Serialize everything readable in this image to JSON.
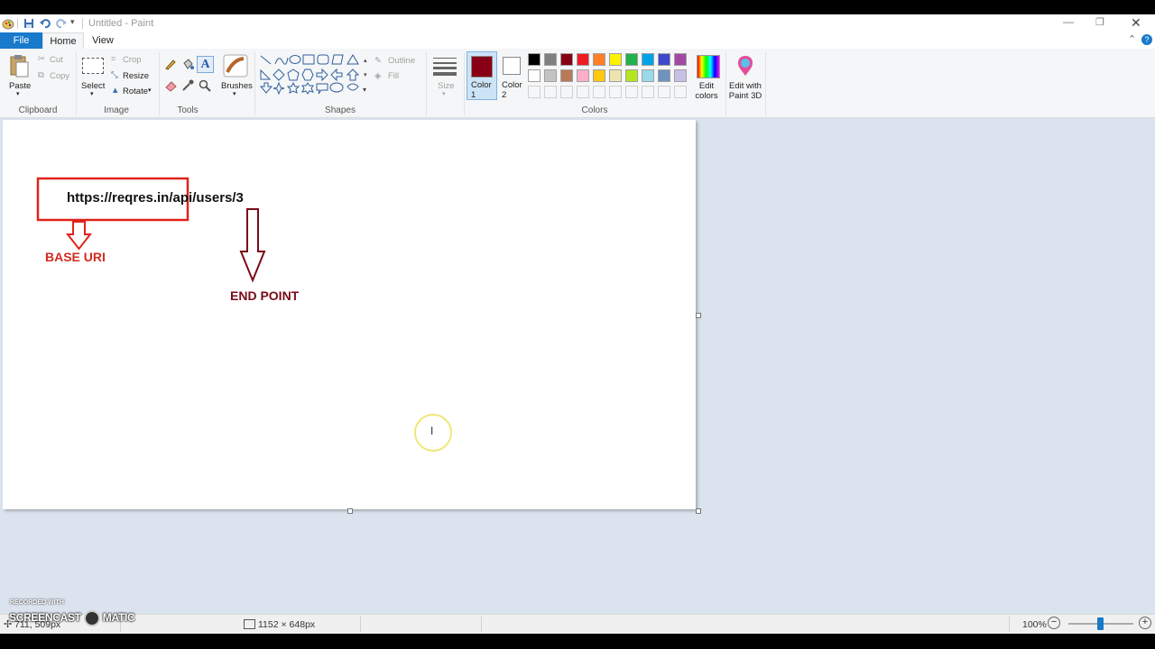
{
  "window": {
    "title": "Untitled - Paint"
  },
  "tabs": {
    "file": "File",
    "home": "Home",
    "view": "View"
  },
  "clipboard": {
    "paste": "Paste",
    "cut": "Cut",
    "copy": "Copy",
    "label": "Clipboard"
  },
  "image": {
    "select": "Select",
    "crop": "Crop",
    "resize": "Resize",
    "rotate": "Rotate",
    "label": "Image"
  },
  "tools": {
    "label": "Tools"
  },
  "brushes": {
    "label": "Brushes"
  },
  "shapes": {
    "outline": "Outline",
    "fill": "Fill",
    "label": "Shapes"
  },
  "size": {
    "label": "Size"
  },
  "colors": {
    "color1": "Color 1",
    "color2": "Color 2",
    "edit_colors": "Edit colors",
    "edit_paint3d": "Edit with Paint 3D",
    "label": "Colors",
    "active_color1": "#880015",
    "active_color2": "#ffffff",
    "palette_row1": [
      "#000000",
      "#7f7f7f",
      "#880015",
      "#ed1c24",
      "#ff7f27",
      "#fff200",
      "#22b14c",
      "#00a2e8",
      "#3f48cc",
      "#a349a4"
    ],
    "palette_row2": [
      "#ffffff",
      "#c3c3c3",
      "#b97a57",
      "#ffaec9",
      "#ffc90e",
      "#efe4b0",
      "#b5e61d",
      "#99d9ea",
      "#7092be",
      "#c8bfe7"
    ]
  },
  "canvas_content": {
    "url_text": "https://reqres.in/api/users/3",
    "base_uri": "BASE URI",
    "end_point": "END POINT"
  },
  "status": {
    "cursor_pos": "711, 509px",
    "canvas_size": "1152 × 648px",
    "zoom": "100%",
    "watermark_recorded": "RECORDED WITH",
    "watermark_brand_left": "SCREENCAST",
    "watermark_brand_right": "MATIC"
  }
}
